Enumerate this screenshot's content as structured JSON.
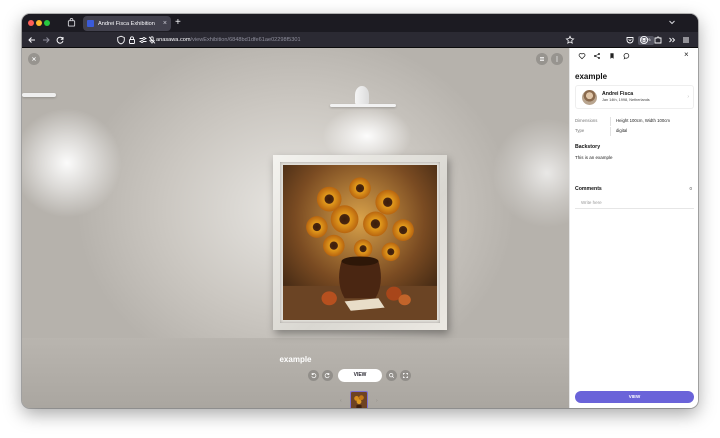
{
  "browser": {
    "tab_title": "Andrei Fisca Exhibition",
    "new_tab": "+",
    "close_tab": "×",
    "url_host": "anasawa.com",
    "url_path": "/viewExhibition/6848bd1dfe61ae02298f5301",
    "zoom": "60%"
  },
  "gallery": {
    "artwork_title": "example",
    "view_label": "VIEW",
    "prev_thumb": "‹",
    "next_thumb": "›"
  },
  "panel": {
    "title": "example",
    "artist": {
      "name": "Andrei Fisca",
      "meta": "Jan 14th, 1998, Netherlands",
      "chevron": "›"
    },
    "meta": [
      {
        "label": "Dimensions",
        "value": "Height 100cm, Width 100cm"
      },
      {
        "label": "Type",
        "value": "digital"
      }
    ],
    "backstory_heading": "Backstory",
    "backstory_text": "This is an example",
    "comments_heading": "Comments",
    "comments_count": "0",
    "comment_placeholder": "Write here",
    "view_label": "VIEW",
    "close": "×"
  },
  "colors": {
    "accent": "#6a63d9",
    "browser_dark": "#2b2a33",
    "tabbar": "#1c1b22"
  }
}
